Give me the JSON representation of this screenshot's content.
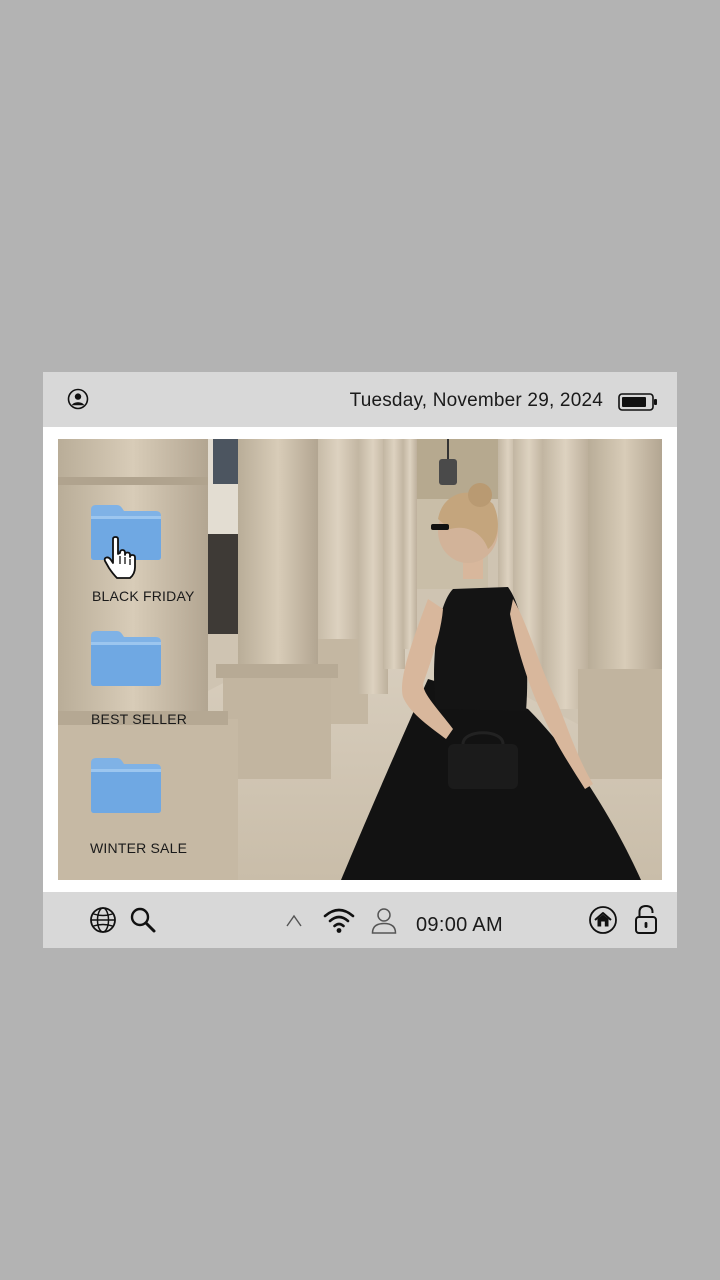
{
  "topbar": {
    "profile_icon": "user-circle-icon",
    "date": "Tuesday, November 29, 2024",
    "battery_icon": "battery-icon"
  },
  "desktop": {
    "folders": [
      {
        "label": "BLACK FRIDAY",
        "icon": "folder-icon"
      },
      {
        "label": "BEST SELLER",
        "icon": "folder-icon"
      },
      {
        "label": "WINTER SALE",
        "icon": "folder-icon"
      }
    ],
    "cursor_icon": "hand-pointer-icon",
    "wallpaper": "photo of woman in black dress walking among stone columns"
  },
  "taskbar": {
    "left_icons": [
      "globe-icon",
      "search-icon"
    ],
    "center_icons": [
      "chevron-up-icon",
      "wifi-icon",
      "user-icon"
    ],
    "time": "09:00 AM",
    "right_icons": [
      "home-icon",
      "lock-icon"
    ]
  },
  "colors": {
    "background": "#b3b3b3",
    "bar": "#d8d8d8",
    "folder": "#6fa8e3"
  }
}
